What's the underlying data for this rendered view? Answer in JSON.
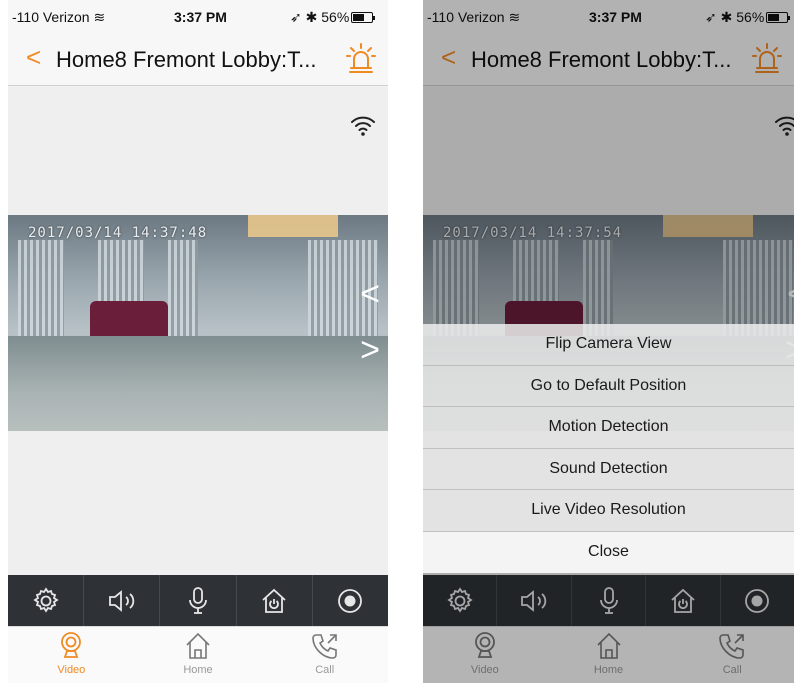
{
  "status": {
    "carrier": "-110 Verizon",
    "time": "3:37 PM",
    "battery": "56%"
  },
  "navbar": {
    "back": "<",
    "title": "Home8 Fremont Lobby:T..."
  },
  "video": {
    "timestamp_left": "2017/03/14  14:37:48",
    "timestamp_right": "2017/03/14  14:37:54",
    "prev": "<",
    "next": ">"
  },
  "tabbar": {
    "video": "Video",
    "home": "Home",
    "call": "Call"
  },
  "menu": {
    "items": [
      "Flip Camera View",
      "Go to Default Position",
      "Motion Detection",
      "Sound Detection",
      "Live Video Resolution"
    ],
    "close": "Close"
  },
  "colors": {
    "accent": "#f08a23",
    "toolbar": "#2e3236"
  }
}
